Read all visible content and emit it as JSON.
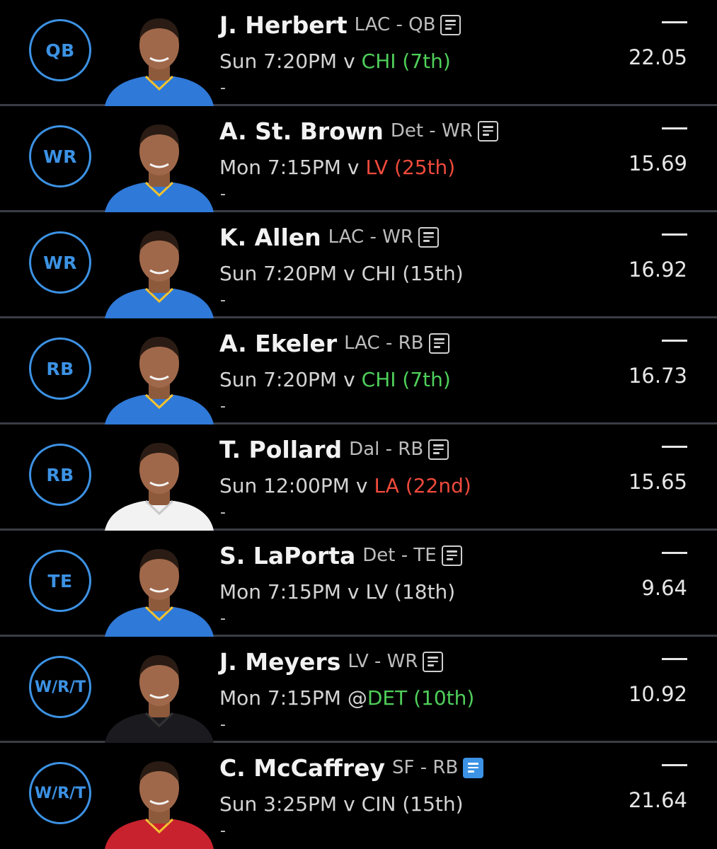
{
  "colors": {
    "accent": "#3c92e4",
    "good_matchup": "#4fcf5a",
    "bad_matchup": "#f04a3c",
    "background": "#000000",
    "divider": "#3a3d44"
  },
  "icons": {
    "news": "news-note-icon",
    "projection": "dash-icon"
  },
  "players": [
    {
      "slot": "QB",
      "name": "J. Herbert",
      "team_pos": "LAC - QB",
      "game": "Sun 7:20PM",
      "sep": "v",
      "opp": "CHI (7th)",
      "opp_tone": "good",
      "extra": "-",
      "projection": "22.05",
      "news_active": false,
      "jersey": "#2f79d8"
    },
    {
      "slot": "WR",
      "name": "A. St. Brown",
      "team_pos": "Det - WR",
      "game": "Mon 7:15PM",
      "sep": "v",
      "opp": "LV (25th)",
      "opp_tone": "bad",
      "extra": "-",
      "projection": "15.69",
      "news_active": false,
      "jersey": "#2f79d8"
    },
    {
      "slot": "WR",
      "name": "K. Allen",
      "team_pos": "LAC - WR",
      "game": "Sun 7:20PM",
      "sep": "v",
      "opp": "CHI (15th)",
      "opp_tone": "neutral",
      "extra": "-",
      "projection": "16.92",
      "news_active": false,
      "jersey": "#2f79d8"
    },
    {
      "slot": "RB",
      "name": "A. Ekeler",
      "team_pos": "LAC - RB",
      "game": "Sun 7:20PM",
      "sep": "v",
      "opp": "CHI (7th)",
      "opp_tone": "good",
      "extra": "-",
      "projection": "16.73",
      "news_active": false,
      "jersey": "#2f79d8"
    },
    {
      "slot": "RB",
      "name": "T. Pollard",
      "team_pos": "Dal - RB",
      "game": "Sun 12:00PM",
      "sep": "v",
      "opp": "LA (22nd)",
      "opp_tone": "bad",
      "extra": "-",
      "projection": "15.65",
      "news_active": false,
      "jersey": "#f2f2f2"
    },
    {
      "slot": "TE",
      "name": "S. LaPorta",
      "team_pos": "Det - TE",
      "game": "Mon 7:15PM",
      "sep": "v",
      "opp": "LV (18th)",
      "opp_tone": "neutral",
      "extra": "-",
      "projection": "9.64",
      "news_active": false,
      "jersey": "#2f79d8"
    },
    {
      "slot": "W/R/T",
      "name": "J. Meyers",
      "team_pos": "LV - WR",
      "game": "Mon 7:15PM",
      "sep": "@",
      "opp": "DET (10th)",
      "opp_tone": "good",
      "extra": "-",
      "projection": "10.92",
      "news_active": false,
      "jersey": "#1a1a1f"
    },
    {
      "slot": "W/R/T",
      "name": "C. McCaffrey",
      "team_pos": "SF - RB",
      "game": "Sun 3:25PM",
      "sep": "v",
      "opp": "CIN (15th)",
      "opp_tone": "neutral",
      "extra": "-",
      "projection": "21.64",
      "news_active": true,
      "jersey": "#c8222e"
    }
  ]
}
